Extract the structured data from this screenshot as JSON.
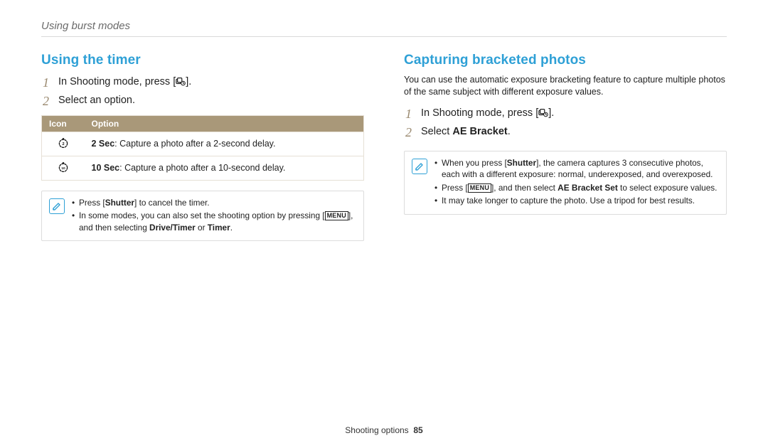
{
  "breadcrumb": "Using burst modes",
  "left": {
    "heading": "Using the timer",
    "steps": {
      "s1_pre": "In Shooting mode, press [",
      "s1_post": "].",
      "s2": "Select an option."
    },
    "table": {
      "h_icon": "Icon",
      "h_option": "Option",
      "r1_bold": "2 Sec",
      "r1_rest": ": Capture a photo after a 2-second delay.",
      "r2_bold": "10 Sec",
      "r2_rest": ": Capture a photo after a 10-second delay."
    },
    "note": {
      "n1_a": "Press [",
      "n1_b": "Shutter",
      "n1_c": "] to cancel the timer.",
      "n2_a": "In some modes, you can also set the shooting option by pressing [",
      "n2_b": "], and then selecting ",
      "n2_c": "Drive/Timer",
      "n2_d": " or ",
      "n2_e": "Timer",
      "n2_f": "."
    }
  },
  "right": {
    "heading": "Capturing bracketed photos",
    "intro": "You can use the automatic exposure bracketing feature to capture multiple photos of the same subject with different exposure values.",
    "steps": {
      "s1_pre": "In Shooting mode, press [",
      "s1_post": "].",
      "s2_a": "Select ",
      "s2_b": "AE Bracket",
      "s2_c": "."
    },
    "note": {
      "n1_a": "When you press [",
      "n1_b": "Shutter",
      "n1_c": "], the camera captures 3 consecutive photos, each with a different exposure: normal, underexposed, and overexposed.",
      "n2_a": "Press [",
      "n2_b": "], and then select ",
      "n2_c": "AE Bracket Set",
      "n2_d": " to select exposure values.",
      "n3": "It may take longer to capture the photo. Use a tripod for best results."
    }
  },
  "footer": {
    "section": "Shooting options",
    "page": "85"
  },
  "labels": {
    "menu": "MENU"
  }
}
